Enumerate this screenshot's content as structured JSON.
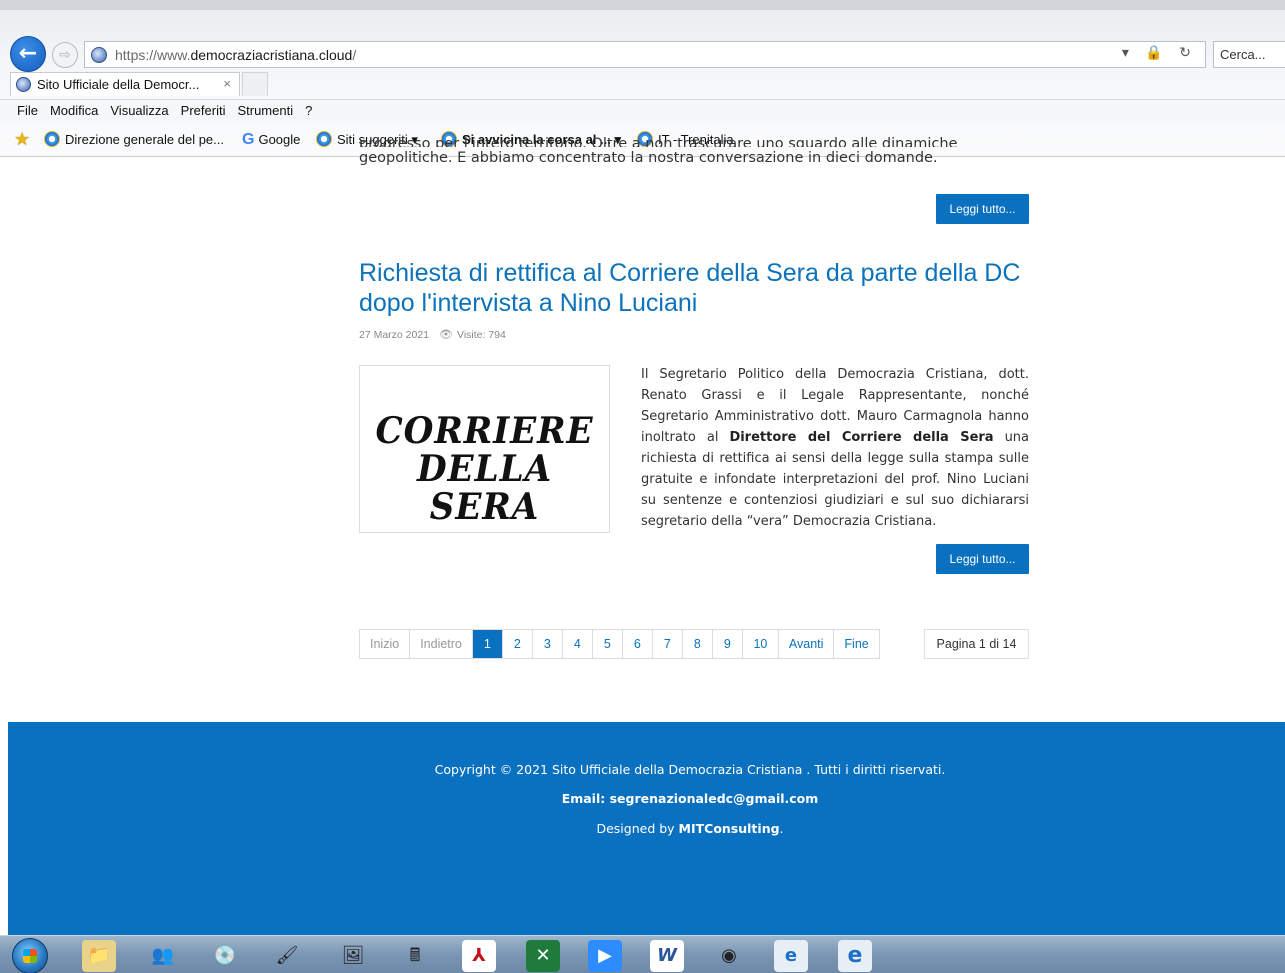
{
  "browser": {
    "url_prefix": "https://www.",
    "url_domain": "democraziacristiana.cloud",
    "url_suffix": "/",
    "search_placeholder": "Cerca...",
    "tab_title": "Sito Ufficiale della Democr...",
    "tab_close": "×",
    "url_tools": "▾ 🔒 ↻",
    "menu": [
      "File",
      "Modifica",
      "Visualizza",
      "Preferiti",
      "Strumenti",
      "?"
    ],
    "favorites": [
      {
        "label": "Direzione generale del pe...",
        "icon": "ie-icon"
      },
      {
        "label": "Google",
        "icon": "google-icon"
      },
      {
        "label": "Siti suggeriti ▾",
        "icon": "ie-icon"
      },
      {
        "label": "Si avvicina la corsa al ... ▾",
        "icon": "ie-icon"
      },
      {
        "label": "IT - Trenitalia",
        "icon": "ie-icon"
      }
    ]
  },
  "previous_article": {
    "cut_text": "progresso per l'intero territorio. Oltre a non trascurare uno sguardo alle dinamiche",
    "last_line": "geopolitiche.  E abbiamo concentrato la nostra conversazione in dieci domande.",
    "read_more": "Leggi tutto..."
  },
  "article": {
    "title": "Richiesta di rettifica al Corriere della Sera da parte della DC dopo l'intervista a Nino Luciani",
    "date": "27 Marzo 2021",
    "visits": "Visite: 794",
    "image_logo_line1": "CORRIERE",
    "image_logo_line2": "DELLA SERA",
    "body_part1": "Il Segretario Politico della Democrazia Cristiana, dott. Renato Grassi e il Legale Rappresentante, nonché Segretario Amministrativo dott. Mauro Carmagnola hanno inoltrato al ",
    "body_bold": "Direttore del Corriere della Sera",
    "body_part2": " una richiesta di rettifica ai sensi della legge sulla stampa sulle gratuite e infondate interpretazioni del prof. Nino Luciani su sentenze e contenziosi giudiziari e sul suo dichiararsi segretario della “vera” Democrazia Cristiana.",
    "read_more": "Leggi tutto..."
  },
  "pagination": {
    "start": "Inizio",
    "prev": "Indietro",
    "pages": [
      "1",
      "2",
      "3",
      "4",
      "5",
      "6",
      "7",
      "8",
      "9",
      "10"
    ],
    "current": "1",
    "next": "Avanti",
    "end": "Fine",
    "page_count": "Pagina 1 di 14"
  },
  "footer": {
    "copyright": "Copyright © 2021 Sito Ufficiale della Democrazia Cristiana . Tutti i diritti riservati.",
    "email": "Email: segrenazionaledc@gmail.com",
    "designed_prefix": "Designed by ",
    "designed_name": "MITConsulting",
    "designed_suffix": "."
  },
  "taskbar": {
    "icons": [
      "explorer-icon",
      "users-icon",
      "disc-icon",
      "paint-icon",
      "photo-icon",
      "calculator-icon",
      "acrobat-icon",
      "excel-icon",
      "zoom-icon",
      "word-icon",
      "chrome-icon",
      "ie-icon",
      "ie-icon"
    ]
  },
  "colors": {
    "accent": "#0a71c0",
    "link": "#0b72bb"
  }
}
